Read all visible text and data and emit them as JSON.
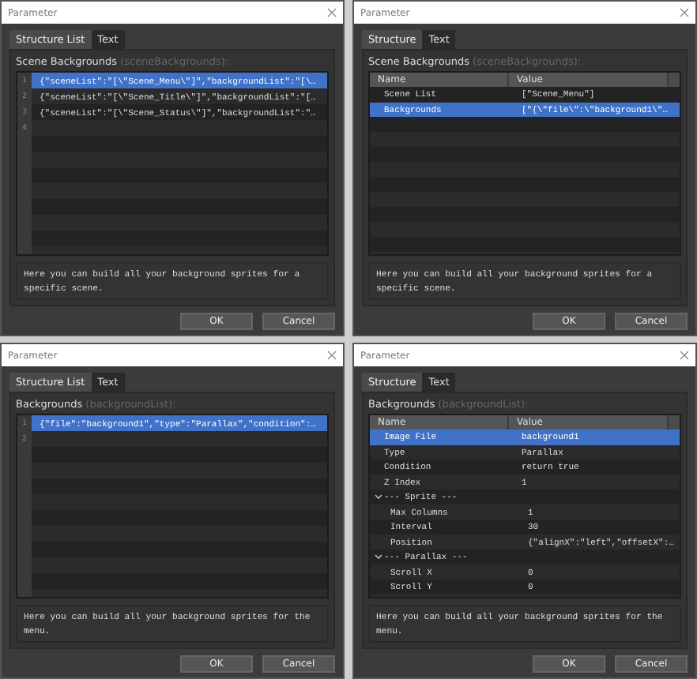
{
  "dialogs": [
    {
      "kind": "list",
      "title": "Parameter",
      "tabs": [
        {
          "label": "Structure List",
          "selected": true
        },
        {
          "label": "Text",
          "selected": false
        }
      ],
      "field_label": "Scene Backgrounds",
      "field_key": "(sceneBackgrounds):",
      "lines": [
        {
          "number": "1",
          "text": "{\"sceneList\":\"[\\\"Scene_Menu\\\"]\",\"backgroundList\":\"[\\…",
          "selected": true
        },
        {
          "number": "2",
          "text": "{\"sceneList\":\"[\\\"Scene_Title\\\"]\",\"backgroundList\":\"[…",
          "selected": false
        },
        {
          "number": "3",
          "text": "{\"sceneList\":\"[\\\"Scene_Status\\\"]\",\"backgroundList\":\"…",
          "selected": false
        },
        {
          "number": "4",
          "selected": false
        }
      ],
      "description": "Here you can build all your background sprites for a specific scene.",
      "buttons": [
        "OK",
        "Cancel"
      ]
    },
    {
      "kind": "structure",
      "title": "Parameter",
      "tabs": [
        {
          "label": "Structure",
          "selected": true
        },
        {
          "label": "Text",
          "selected": false
        }
      ],
      "field_label": "Scene Backgrounds",
      "field_key": "(sceneBackgrounds):",
      "columns": [
        "Name",
        "Value"
      ],
      "rows": [
        {
          "name": "Scene List",
          "value": "[\"Scene_Menu\"]",
          "selected": false
        },
        {
          "name": "Backgrounds",
          "value": "[\"{\\\"file\\\":\\\"background1\\\"…",
          "selected": true
        }
      ],
      "description": "Here you can build all your background sprites for a specific scene.",
      "buttons": [
        "OK",
        "Cancel"
      ]
    },
    {
      "kind": "list",
      "title": "Parameter",
      "tabs": [
        {
          "label": "Structure List",
          "selected": true
        },
        {
          "label": "Text",
          "selected": false
        }
      ],
      "field_label": "Backgrounds",
      "field_key": "(backgroundList):",
      "lines": [
        {
          "number": "1",
          "text": "{\"file\":\"background1\",\"type\":\"Parallax\",\"condition\":…",
          "selected": true
        },
        {
          "number": "2",
          "selected": false
        }
      ],
      "description": "Here you can build all your background sprites for the menu.",
      "buttons": [
        "OK",
        "Cancel"
      ]
    },
    {
      "kind": "structure",
      "title": "Parameter",
      "tabs": [
        {
          "label": "Structure",
          "selected": true
        },
        {
          "label": "Text",
          "selected": false
        }
      ],
      "field_label": "Backgrounds",
      "field_key": "(backgroundList):",
      "columns": [
        "Name",
        "Value"
      ],
      "rows": [
        {
          "name": "Image File",
          "value": "background1",
          "selected": true
        },
        {
          "name": "Type",
          "value": "Parallax",
          "selected": false
        },
        {
          "name": "Condition",
          "value": "return true",
          "selected": false
        },
        {
          "name": "Z Index",
          "value": "1",
          "selected": false
        },
        {
          "name": "--- Sprite ---",
          "selected": false,
          "expanded": true,
          "children": [
            {
              "name": "Max Columns",
              "value": "1",
              "selected": false
            },
            {
              "name": "Interval",
              "value": "30",
              "selected": false
            },
            {
              "name": "Position",
              "value": "{\"alignX\":\"left\",\"offsetX\":…",
              "selected": false
            }
          ]
        },
        {
          "name": "--- Parallax ---",
          "selected": false,
          "expanded": true,
          "children": [
            {
              "name": "Scroll X",
              "value": "0",
              "selected": false
            },
            {
              "name": "Scroll Y",
              "value": "0",
              "selected": false
            }
          ]
        }
      ],
      "description": "Here you can build all your background sprites for the menu.",
      "buttons": [
        "OK",
        "Cancel"
      ]
    }
  ]
}
